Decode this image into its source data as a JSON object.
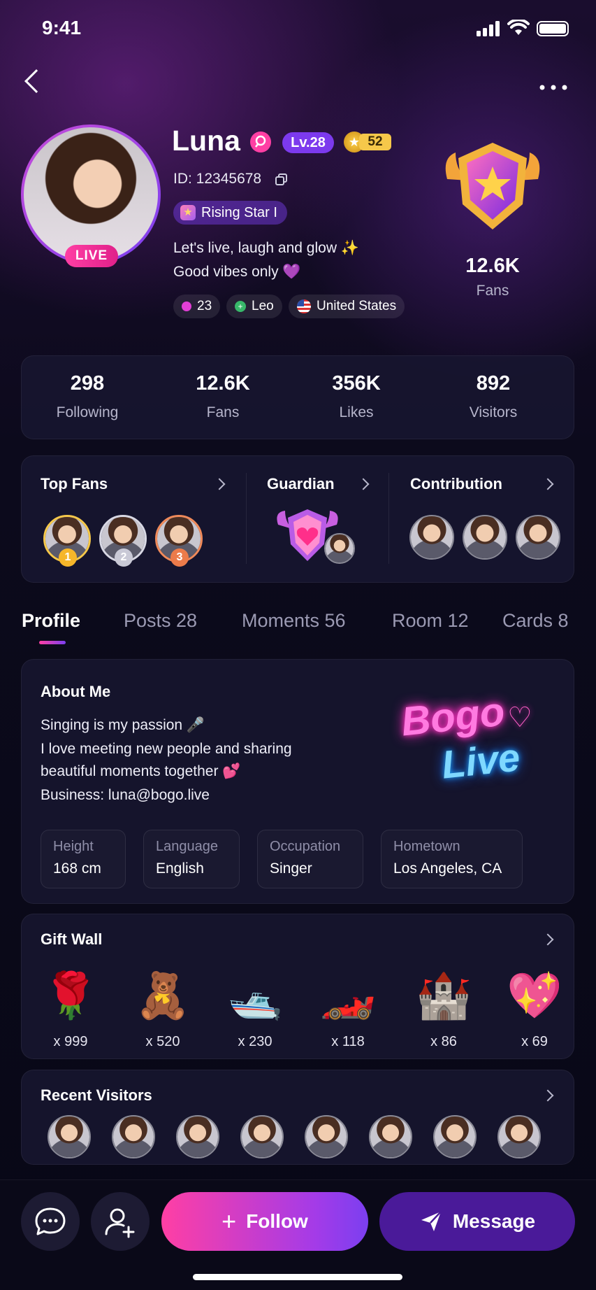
{
  "status_bar": {
    "time": "9:41"
  },
  "profile": {
    "name": "Luna",
    "level": "Lv.28",
    "crown_count": "52",
    "id_text": "ID: 12345678",
    "badge": "Rising Star I",
    "bio_line1": "Let's live, laugh and glow ✨",
    "bio_line2": "Good vibes only 💜",
    "live_label": "LIVE",
    "tags": [
      {
        "icon": "gem-icon",
        "label": "23"
      },
      {
        "icon": "zodiac-icon",
        "label": "Leo"
      },
      {
        "icon": "us-flag-icon",
        "label": "United States"
      }
    ],
    "fans_count": "12.6K",
    "fans_label": "Fans"
  },
  "stats": [
    {
      "value": "298",
      "label": "Following"
    },
    {
      "value": "12.6K",
      "label": "Fans"
    },
    {
      "value": "356K",
      "label": "Likes"
    },
    {
      "value": "892",
      "label": "Visitors"
    }
  ],
  "sections": {
    "top_fans": "Top Fans",
    "guardian": "Guardian",
    "contribution": "Contribution",
    "ranks": [
      "1",
      "2",
      "3"
    ]
  },
  "tabs": [
    {
      "label": "Profile",
      "active": true
    },
    {
      "label": "Posts 28"
    },
    {
      "label": "Moments 56"
    },
    {
      "label": "Room 12"
    },
    {
      "label": "Cards 8"
    }
  ],
  "about": {
    "title": "About Me",
    "line1": "Singing is my passion 🎤",
    "line2": "I love meeting new people and sharing",
    "line3": "beautiful moments together 💕",
    "line4": "Business: luna@bogo.live",
    "logo_line1": "Bogo",
    "logo_line2": "Live",
    "details": [
      {
        "key": "Height",
        "value": "168 cm"
      },
      {
        "key": "Language",
        "value": "English"
      },
      {
        "key": "Occupation",
        "value": "Singer"
      },
      {
        "key": "Hometown",
        "value": "Los Angeles, CA"
      }
    ]
  },
  "gift_wall": {
    "title": "Gift Wall",
    "gifts": [
      {
        "icon": "🌹",
        "count": "x 999"
      },
      {
        "icon": "🧸",
        "count": "x 520"
      },
      {
        "icon": "🛥️",
        "count": "x 230"
      },
      {
        "icon": "🏎️",
        "count": "x 118"
      },
      {
        "icon": "🏰",
        "count": "x 86"
      },
      {
        "icon": "💖",
        "count": "x 69"
      }
    ]
  },
  "recent_visitors": {
    "title": "Recent Visitors"
  },
  "actions": {
    "follow": "Follow",
    "message": "Message"
  },
  "colors": {
    "accent_pink": "#ff3fa4",
    "accent_purple": "#7b2ff7",
    "level_badge": "#7c3aed"
  }
}
